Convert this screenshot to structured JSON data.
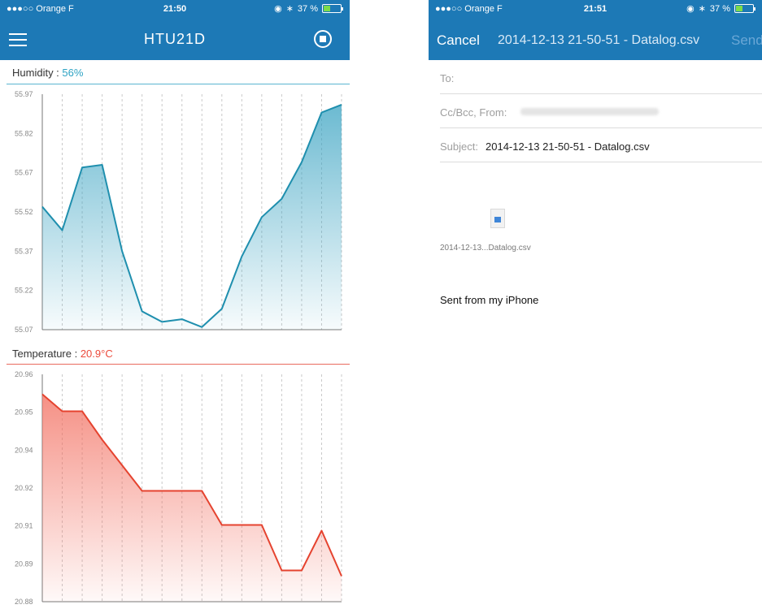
{
  "left_screen": {
    "status_bar": {
      "carrier": "●●●○○ Orange F",
      "time": "21:50",
      "battery": "37 %"
    },
    "nav": {
      "title": "HTU21D",
      "menu_icon": "hamburger-icon",
      "record_icon": "record-stop-icon"
    },
    "humidity": {
      "label": "Humidity : ",
      "value": "56%"
    },
    "temperature": {
      "label": "Temperature : ",
      "value": "20.9°C"
    }
  },
  "right_screen": {
    "status_bar": {
      "carrier": "●●●○○ Orange F",
      "time": "21:51",
      "battery": "37 %"
    },
    "nav": {
      "cancel": "Cancel",
      "title": "2014-12-13 21-50-51 - Datalog.csv",
      "send": "Send"
    },
    "fields": {
      "to_label": "To:",
      "cc_label": "Cc/Bcc, From:",
      "subject_label": "Subject:",
      "subject_value": "2014-12-13 21-50-51 - Datalog.csv"
    },
    "attachment": {
      "label": "2014-12-13...Datalog.csv",
      "icon": "spreadsheet-file-icon"
    },
    "signature": "Sent from my iPhone"
  },
  "colors": {
    "nav_blue": "#1d79b6",
    "humidity_line": "#1f8fae",
    "temperature_line": "#e5432f"
  },
  "chart_data": [
    {
      "type": "area",
      "title": "Humidity",
      "ylim": [
        55.07,
        55.97
      ],
      "yticks": [
        "55.97",
        "55.82",
        "55.67",
        "55.52",
        "55.37",
        "55.22",
        "55.07"
      ],
      "x": [
        0,
        1,
        2,
        3,
        4,
        5,
        6,
        7,
        8,
        9,
        10,
        11,
        12,
        13,
        14,
        15
      ],
      "values": [
        55.54,
        55.45,
        55.69,
        55.7,
        55.37,
        55.14,
        55.1,
        55.11,
        55.08,
        55.15,
        55.35,
        55.5,
        55.57,
        55.71,
        55.9,
        55.93
      ]
    },
    {
      "type": "area",
      "title": "Temperature",
      "ylim": [
        20.88,
        20.96
      ],
      "yticks": [
        "20.96",
        "20.95",
        "20.94",
        "20.92",
        "20.91",
        "20.89",
        "20.88"
      ],
      "x": [
        0,
        1,
        2,
        3,
        4,
        5,
        6,
        7,
        8,
        9,
        10,
        11,
        12,
        13,
        14,
        15
      ],
      "values": [
        20.953,
        20.947,
        20.947,
        20.937,
        20.928,
        20.919,
        20.919,
        20.919,
        20.919,
        20.907,
        20.907,
        20.907,
        20.891,
        20.891,
        20.905,
        20.889
      ]
    }
  ]
}
